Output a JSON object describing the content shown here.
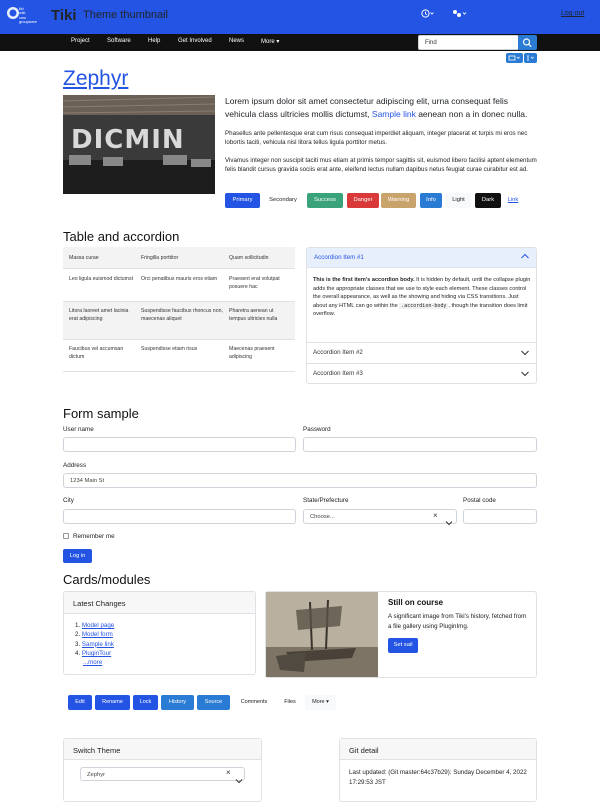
{
  "topbar": {
    "logo_small_lines": [
      "tiki",
      "wiki",
      "cms",
      "groupware"
    ],
    "logo_text": "Tiki",
    "site_title": "Theme thumbnail",
    "clock_icon": "clock-icon",
    "gear_icon": "gear-icon",
    "logout_label": "Log out"
  },
  "nav": {
    "items": [
      "Project",
      "Software",
      "Help",
      "Get Involved",
      "News",
      "More ▾"
    ],
    "search_placeholder": "Find"
  },
  "hero": {
    "title": "Zephyr",
    "image_text": "DICMIN",
    "lead_before": "Lorem ipsum dolor sit amet consectetur adipiscing elit, urna consequat felis vehicula class ultricies mollis dictumst, ",
    "lead_link": "Sample link",
    "lead_after": " aenean non a in donec nulla.",
    "para1": "Phasellus ante pellentesque erat cum risus consequat imperdiet aliquam, integer placerat et turpis mi eros nec lobortis taciti, vehicula nisl litora tellus ligula porttitor metus.",
    "para2": "Vivamus integer non suscipit taciti mus etiam at primis tempor sagittis sit, euismod libero facilisi aptent elementum felis blandit cursus gravida sociis erat ante, eleifend lectus nullam dapibus netus feugiat curae curabitur est ad.",
    "buttons": [
      "Primary",
      "Secondary",
      "Success",
      "Danger",
      "Warning",
      "Info",
      "Light",
      "Dark",
      "Link"
    ]
  },
  "table_section": {
    "heading": "Table and accordion",
    "headers": [
      "Massa curae",
      "Fringilla porttitor",
      "Quam sollicitudin"
    ],
    "rows": [
      [
        "Leo ligula euismod dictumst",
        "Orci penatibus mauris eros etiam",
        "Praesent erat volutpat posuere hac"
      ],
      [
        "Litora laoreet amet lacinia erat adipiscing",
        "Suspendisse faucibus rhoncus non, maecenas aliquet",
        "Pharetra aenean ut tempus ultricies nulla"
      ],
      [
        "Faucibus vel accumsan dictum",
        "Suspendisse etiam risus",
        "Maecenas praesent adipiscing"
      ]
    ],
    "accordion": {
      "item1_title": "Accordion Item #1",
      "item1_body_bold": "This is the first item's accordion body.",
      "item1_body": " It is hidden by default, until the collapse plugin adds the appropriate classes that we use to style each element. These classes control the overall appearance, as well as the showing and hiding via CSS transitions. Just about any HTML can go within the ",
      "item1_code": ".accordion-body",
      "item1_body_end": ", though the transition does limit overflow.",
      "item2_title": "Accordion Item #2",
      "item3_title": "Accordion Item #3"
    }
  },
  "form": {
    "heading": "Form sample",
    "username_label": "User name",
    "password_label": "Password",
    "address_label": "Address",
    "address_value": "1234 Main St",
    "city_label": "City",
    "state_label": "State/Prefecture",
    "state_value": "Choose...",
    "postal_label": "Postal code",
    "remember_label": "Remember me",
    "login_label": "Log in"
  },
  "cards": {
    "heading": "Cards/modules",
    "latest_title": "Latest Changes",
    "latest_items": [
      "Model page",
      "Model form",
      "Sample link",
      "PluginTour"
    ],
    "more_label": "...more",
    "course_title": "Still on course",
    "course_text": "A significant image from Tiki's history, fetched from a file gallery using PluginImg.",
    "set_sail_label": "Set sail"
  },
  "toolbar": {
    "buttons": [
      "Edit",
      "Rename",
      "Lock",
      "History",
      "Source",
      "Comments",
      "Files",
      "More ▾"
    ]
  },
  "switch_theme": {
    "title": "Switch Theme",
    "value": "Zephyr"
  },
  "git": {
    "title": "Git detail",
    "text": "Last updated: (Git master:64c37b29): Sunday December 4, 2022 17:29:53 JST"
  },
  "colors": {
    "primary": "#2454e3",
    "success": "#3aa37a",
    "danger": "#d93939",
    "warning": "#c9a36c",
    "info": "#2a7bd3",
    "dark": "#111111"
  }
}
